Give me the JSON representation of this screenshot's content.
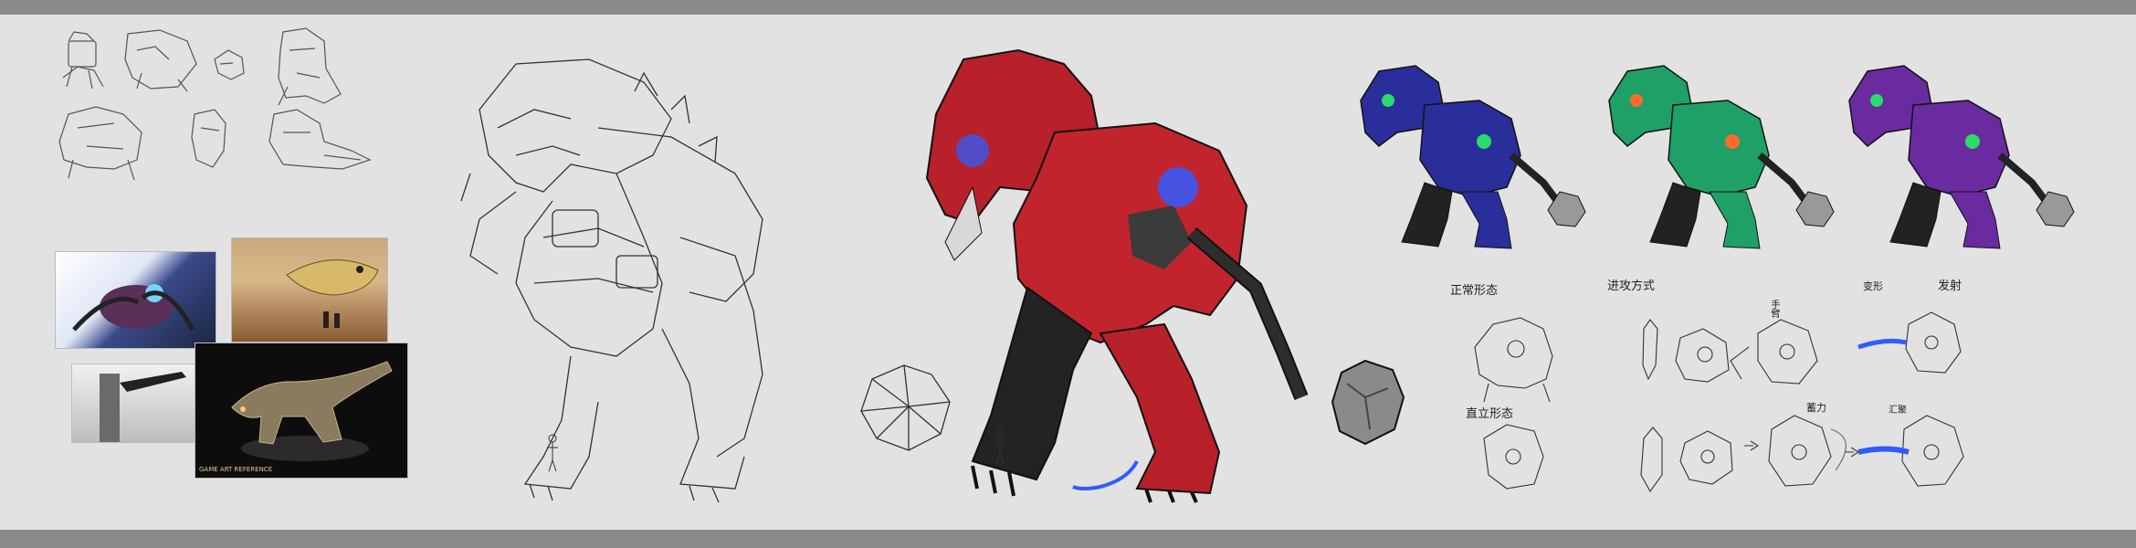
{
  "annotations": {
    "standing_form": "正常形态",
    "attack_method": "进攻方式",
    "transform": "变形",
    "charge": "蓄力",
    "launch": "发射",
    "upright_form": "直立形态",
    "arm_label": "手臂",
    "gather": "汇聚"
  },
  "reference_captions": {
    "creature_statue": "GAME ART REFERENCE"
  },
  "palette": {
    "background": "#e2e2e2",
    "frame": "#8a8a8a",
    "red_variant": "#b8202a",
    "blue_variant": "#2a2e9a",
    "green_variant": "#1fa066",
    "purple_variant": "#6a2aa0",
    "energy_glow": "#2f5cff",
    "line_art": "#333333"
  },
  "icons": [
    "thumbnail-sketch-icon",
    "line-art-robot-icon",
    "spiked-mace-icon",
    "human-scale-figure-icon"
  ]
}
